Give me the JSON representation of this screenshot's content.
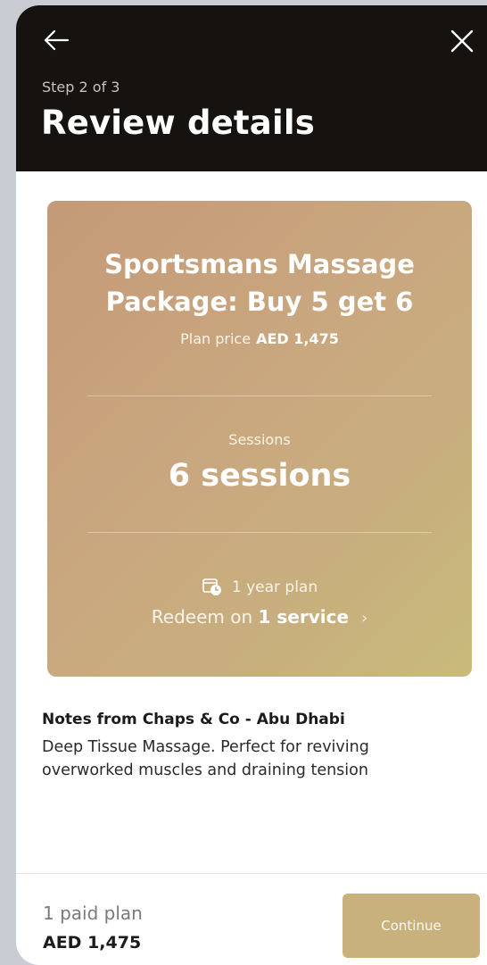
{
  "header": {
    "step": "Step 2 of 3",
    "title": "Review details",
    "back_icon": "arrow-left-icon",
    "close_icon": "close-icon"
  },
  "plan_card": {
    "name": "Sportsmans Massage Package: Buy 5 get 6",
    "price_label": "Plan price",
    "price_value": "AED 1,475",
    "sessions_label": "Sessions",
    "sessions_value": "6 sessions",
    "duration_icon": "clock-calendar-icon",
    "duration": "1 year plan",
    "redeem_prefix": "Redeem on",
    "redeem_count": "1 service",
    "redeem_chevron": "›"
  },
  "notes": {
    "title": "Notes from Chaps & Co - Abu Dhabi",
    "body": "Deep Tissue Massage. Perfect for reviving overworked muscles and draining tension"
  },
  "footer": {
    "plans_count": "1 paid plan",
    "total": "AED 1,475",
    "continue_label": "Continue"
  },
  "colors": {
    "header_bg": "#15120f",
    "card_gradient_start": "#c49a77",
    "card_gradient_end": "#c9bb7c",
    "button_bg": "#c8b17d"
  }
}
